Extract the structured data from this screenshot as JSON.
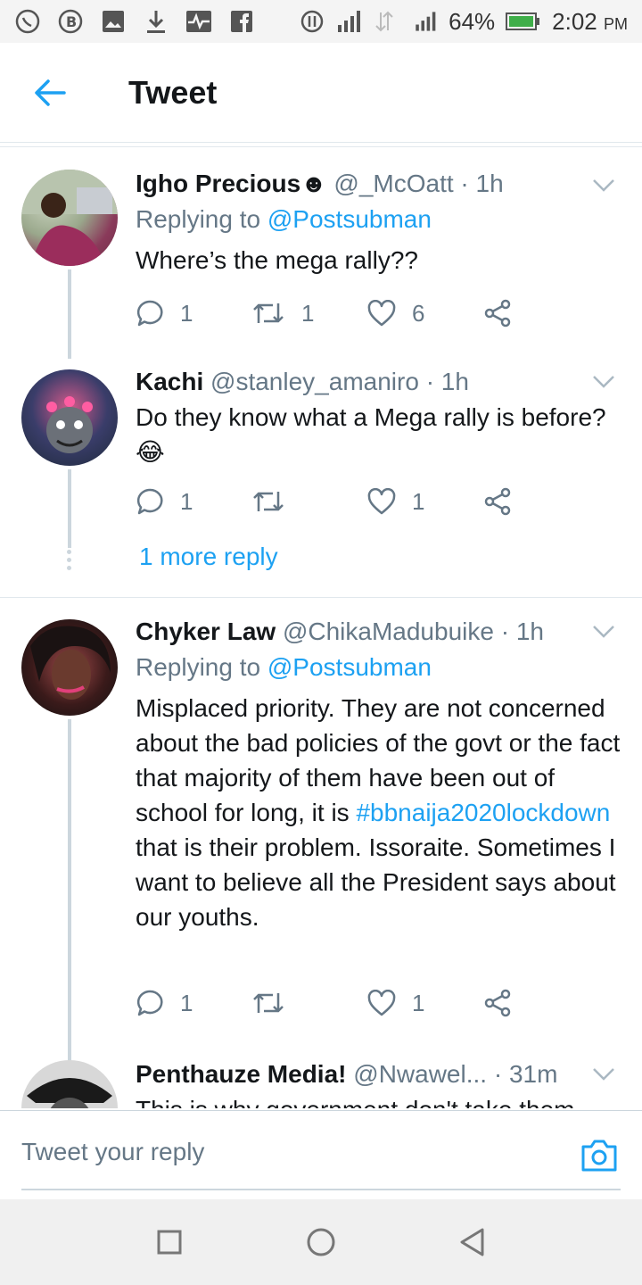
{
  "status_bar": {
    "battery_percent": "64%",
    "time": "2:02",
    "ampm": "PM",
    "icons": [
      "whatsapp-icon",
      "b-icon",
      "image-icon",
      "download-icon",
      "activity-icon",
      "facebook-icon",
      "data-icon",
      "signal-icon",
      "signal-icon",
      "battery-icon"
    ]
  },
  "header": {
    "title": "Tweet",
    "back_icon": "arrow-left-icon"
  },
  "colors": {
    "accent": "#1da1f2",
    "text": "#14171a",
    "muted": "#657786",
    "divider": "#e1e8ed"
  },
  "tweets": [
    {
      "name": "Igho Precious☻",
      "handle": "@_McOatt",
      "time": "· 1h",
      "replying_prefix": "Replying to",
      "replying_to": "@Postsubman",
      "text": "Where’s the mega rally??",
      "replies": "1",
      "retweets": "1",
      "likes": "6"
    },
    {
      "name": "Kachi",
      "handle": "@stanley_amaniro",
      "time": "· 1h",
      "text": "Do they know what a Mega rally is before? 😂",
      "replies": "1",
      "retweets": "",
      "likes": "1",
      "more_reply": "1 more reply"
    },
    {
      "name": "Chyker Law",
      "handle": "@ChikaMadubuike",
      "time": "· 1h",
      "replying_prefix": "Replying to",
      "replying_to": "@Postsubman",
      "text_before": "Misplaced priority. They are not concerned about the bad policies of the govt or the fact that majority of them have been out of school for long, it is ",
      "hashtag": "#bbnaija2020lockdown",
      "text_after": " that is their problem. Issoraite. Sometimes I want to believe all the President says about our youths.",
      "replies": "1",
      "retweets": "",
      "likes": "1"
    },
    {
      "name": "Penthauze Media!",
      "handle": "@Nwawel...",
      "time": "· 31m",
      "text": "This is why government don't take them"
    }
  ],
  "reply_bar": {
    "placeholder": "Tweet your reply"
  }
}
